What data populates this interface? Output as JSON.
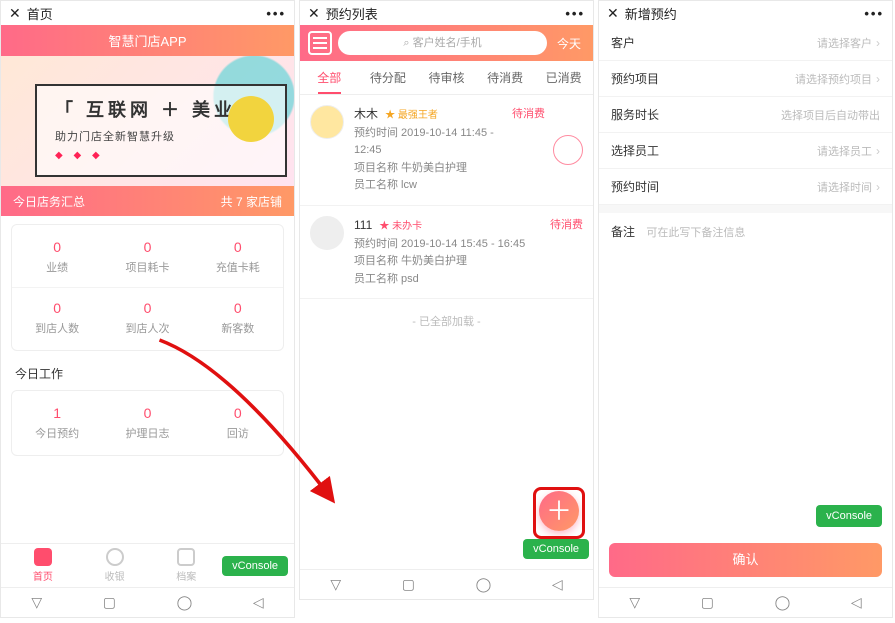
{
  "screen1": {
    "top": {
      "close": "✕",
      "title": "首页",
      "dots": "•••"
    },
    "header": "智慧门店APP",
    "banner": {
      "title": "「 互联网  ＋  美业 」",
      "sub": "助力门店全新智慧升级",
      "diam": "◆ ◆ ◆"
    },
    "summary": {
      "left": "今日店务汇总",
      "right": "共 7 家店铺"
    },
    "stats1": [
      {
        "v": "0",
        "l": "业绩"
      },
      {
        "v": "0",
        "l": "项目耗卡"
      },
      {
        "v": "0",
        "l": "充值卡耗"
      }
    ],
    "stats2": [
      {
        "v": "0",
        "l": "到店人数"
      },
      {
        "v": "0",
        "l": "到店人次"
      },
      {
        "v": "0",
        "l": "新客数"
      }
    ],
    "today_work": "今日工作",
    "stats3": [
      {
        "v": "1",
        "l": "今日预约"
      },
      {
        "v": "0",
        "l": "护理日志"
      },
      {
        "v": "0",
        "l": "回访"
      }
    ],
    "tabbar": {
      "home": "首页",
      "cash": "收银",
      "file": "档案"
    },
    "vconsole": "vConsole"
  },
  "screen2": {
    "top": {
      "close": "✕",
      "title": "预约列表",
      "dots": "•••"
    },
    "search_placeholder": "客户姓名/手机",
    "today": "今天",
    "tabs": [
      "全部",
      "待分配",
      "待审核",
      "待消费",
      "已消费"
    ],
    "appts": [
      {
        "name": "木木",
        "tag": "最强王者",
        "tag_cls": "",
        "time": "预约时间 2019-10-14 11:45 - 12:45",
        "proj": "项目名称 牛奶美白护理",
        "emp": "员工名称 lcw",
        "status": "待消费",
        "scan": true
      },
      {
        "name": "111",
        "tag": "未办卡",
        "tag_cls": "red",
        "time": "预约时间 2019-10-14 15:45 - 16:45",
        "proj": "项目名称 牛奶美白护理",
        "emp": "员工名称 psd",
        "status": "待消费",
        "scan": false
      }
    ],
    "end": "- 已全部加载 -",
    "add": "＋",
    "vconsole": "vConsole"
  },
  "screen3": {
    "top": {
      "close": "✕",
      "title": "新增预约",
      "dots": "•••"
    },
    "rows": [
      {
        "lbl": "客户",
        "val": "请选择客户",
        "chev": true
      },
      {
        "lbl": "预约项目",
        "val": "请选择预约项目",
        "chev": true
      },
      {
        "lbl": "服务时长",
        "val": "选择项目后自动带出",
        "chev": false
      },
      {
        "lbl": "选择员工",
        "val": "请选择员工",
        "chev": true
      },
      {
        "lbl": "预约时间",
        "val": "请选择时间",
        "chev": true
      }
    ],
    "note_lbl": "备注",
    "note_ph": "可在此写下备注信息",
    "vconsole": "vConsole",
    "confirm": "确认"
  },
  "navkeys": [
    "▽",
    "▢",
    "◯",
    "◁"
  ],
  "search_glyph": "⌕"
}
